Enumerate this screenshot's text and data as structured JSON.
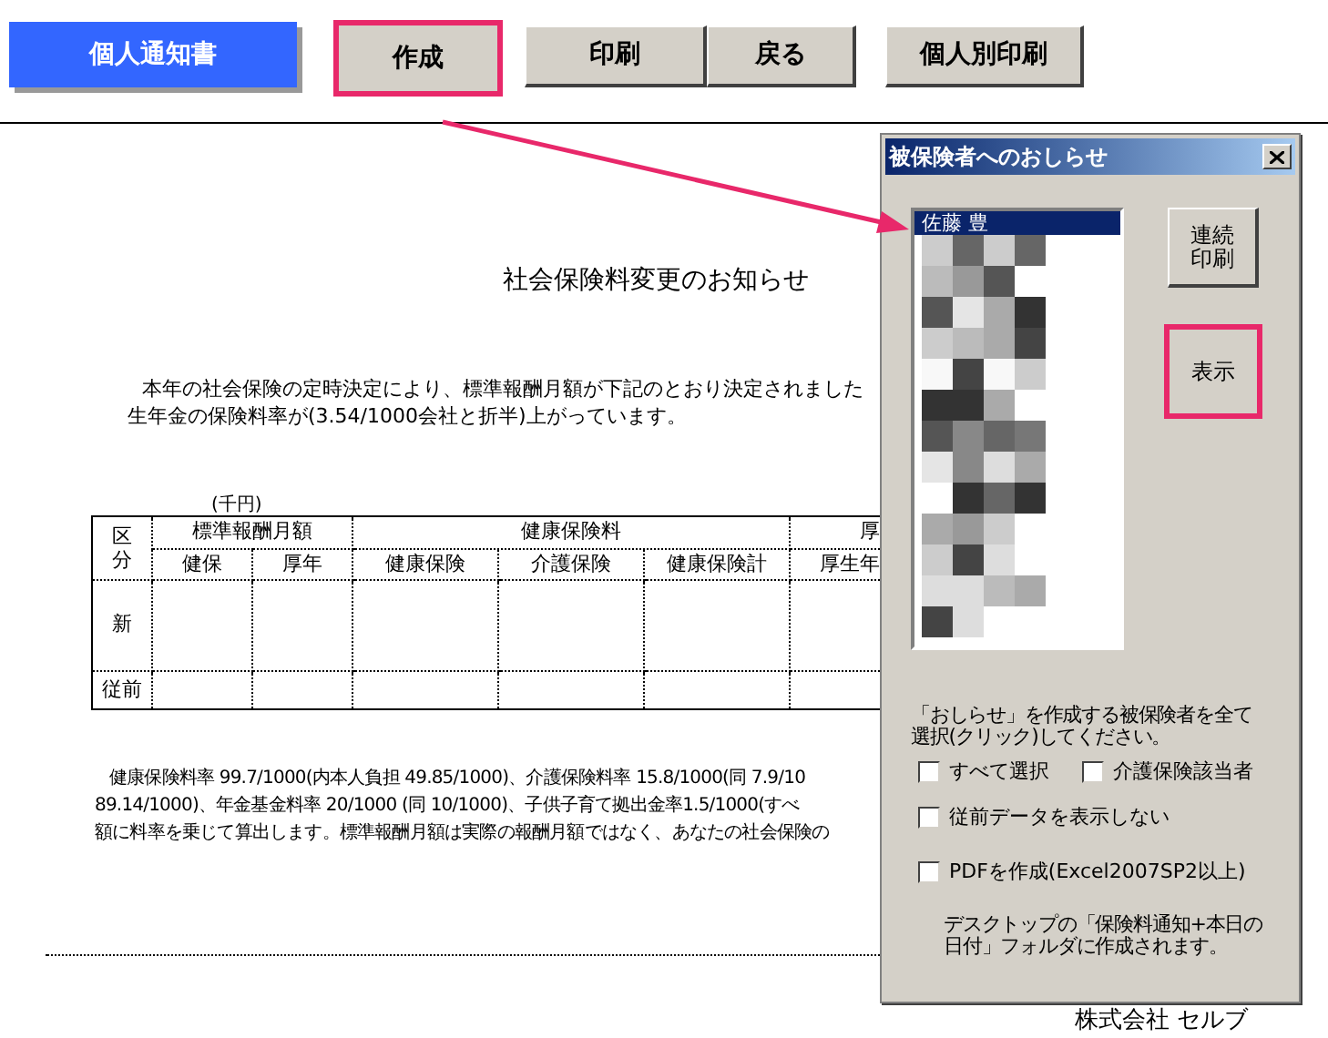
{
  "toolbar": {
    "buttons": [
      {
        "label": "個人通知書",
        "kind": "primary",
        "highlighted": false
      },
      {
        "label": "作成",
        "kind": "normal",
        "highlighted": true
      },
      {
        "label": "印刷",
        "kind": "normal",
        "highlighted": false
      },
      {
        "label": "戻る",
        "kind": "normal",
        "highlighted": false
      },
      {
        "label": "個人別印刷",
        "kind": "normal",
        "highlighted": false
      }
    ]
  },
  "document": {
    "title": "社会保険料変更のお知らせ",
    "paragraph": [
      "本年の社会保険の定時決定により、標準報酬月額が下記のとおり決定されました",
      "生年金の保険料率が(3.54/1000会社と折半)上がっています。"
    ],
    "unit": "(千円)",
    "table": {
      "group_headers": [
        "標準報酬月額",
        "健康保険料",
        "厚"
      ],
      "corner": "区分",
      "columns": [
        "健保",
        "厚年",
        "健康保険",
        "介護保険",
        "健康保険計",
        "厚生年"
      ],
      "rows": [
        {
          "label": "新",
          "kind": "tall"
        },
        {
          "label": "従前",
          "kind": "short"
        }
      ]
    },
    "notes": [
      "健康保険料率 99.7/1000(内本人負担 49.85/1000)、介護保険料率 15.8/1000(同 7.9/10",
      "89.14/1000)、年金基金料率 20/1000 (同 10/1000)、子供子育て拠出金率1.5/1000(すべ",
      "額に料率を乗じて算出します。標準報酬月額は実際の報酬月額ではなく、あなたの社会保険の"
    ],
    "footer": "株式会社 セルブ"
  },
  "dialog": {
    "title": "被保険者へのおしらせ",
    "list": [
      {
        "label": "佐藤 豊",
        "selected": true
      }
    ],
    "buttons": [
      {
        "label": "連続印刷",
        "highlighted": false
      },
      {
        "label": "表示",
        "highlighted": true
      }
    ],
    "instruction": "「おしらせ」を作成する被保険者を全て選択(クリック)してください。",
    "checkboxes": [
      {
        "label": "すべて選択",
        "checked": false
      },
      {
        "label": "介護保険該当者",
        "checked": false
      },
      {
        "label": "従前データを表示しない",
        "checked": false
      },
      {
        "label": "PDFを作成(Excel2007SP2以上)",
        "checked": false
      }
    ],
    "note": "デスクトップの「保険料通知+本日の日付」フォルダに作成されます。"
  }
}
